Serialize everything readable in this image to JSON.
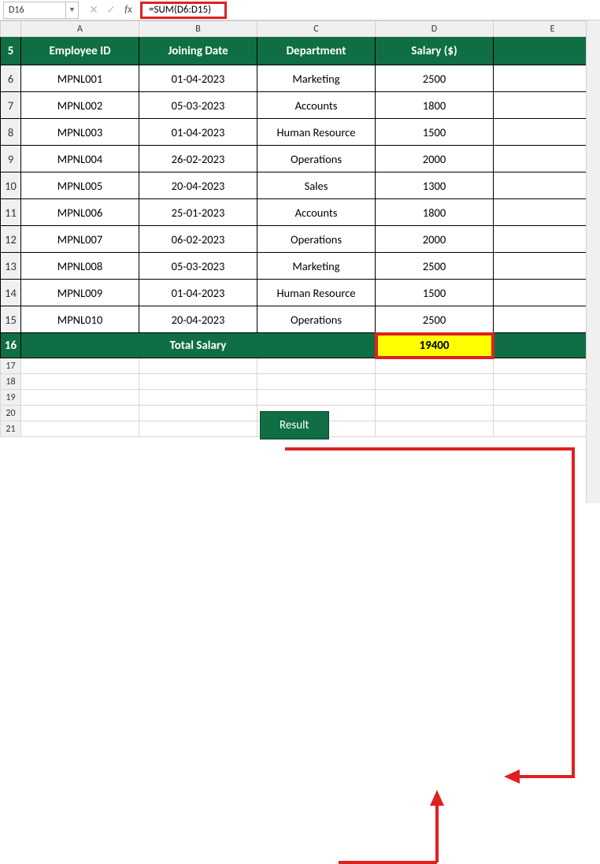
{
  "name_box": "D16",
  "formula": "=SUM(D6:D15)",
  "col_letters": [
    "A",
    "B",
    "C",
    "D",
    "E"
  ],
  "row_nums": [
    "5",
    "6",
    "7",
    "8",
    "9",
    "10",
    "11",
    "12",
    "13",
    "14",
    "15",
    "16",
    "17",
    "18",
    "19",
    "20",
    "21"
  ],
  "headers": {
    "c0": "Employee ID",
    "c1": "Joining Date",
    "c2": "Department",
    "c3": "Salary ($)"
  },
  "rows": [
    {
      "id": "MPNL001",
      "date": "01-04-2023",
      "dept": "Marketing",
      "sal": "2500"
    },
    {
      "id": "MPNL002",
      "date": "05-03-2023",
      "dept": "Accounts",
      "sal": "1800"
    },
    {
      "id": "MPNL003",
      "date": "01-04-2023",
      "dept": "Human Resource",
      "sal": "1500"
    },
    {
      "id": "MPNL004",
      "date": "26-02-2023",
      "dept": "Operations",
      "sal": "2000"
    },
    {
      "id": "MPNL005",
      "date": "20-04-2023",
      "dept": "Sales",
      "sal": "1300"
    },
    {
      "id": "MPNL006",
      "date": "25-01-2023",
      "dept": "Accounts",
      "sal": "1800"
    },
    {
      "id": "MPNL007",
      "date": "06-02-2023",
      "dept": "Operations",
      "sal": "2000"
    },
    {
      "id": "MPNL008",
      "date": "05-03-2023",
      "dept": "Marketing",
      "sal": "2500"
    },
    {
      "id": "MPNL009",
      "date": "01-04-2023",
      "dept": "Human Resource",
      "sal": "1500"
    },
    {
      "id": "MPNL010",
      "date": "20-04-2023",
      "dept": "Operations",
      "sal": "2500"
    }
  ],
  "total_label": "Total Salary",
  "total_value": "19400",
  "result_label": "Result",
  "chart_data": {
    "type": "table",
    "title": "Employee Salary Table with SUM",
    "columns": [
      "Employee ID",
      "Joining Date",
      "Department",
      "Salary ($)"
    ],
    "data": [
      [
        "MPNL001",
        "01-04-2023",
        "Marketing",
        2500
      ],
      [
        "MPNL002",
        "05-03-2023",
        "Accounts",
        1800
      ],
      [
        "MPNL003",
        "01-04-2023",
        "Human Resource",
        1500
      ],
      [
        "MPNL004",
        "26-02-2023",
        "Operations",
        2000
      ],
      [
        "MPNL005",
        "20-04-2023",
        "Sales",
        1300
      ],
      [
        "MPNL006",
        "25-01-2023",
        "Accounts",
        1800
      ],
      [
        "MPNL007",
        "06-02-2023",
        "Operations",
        2000
      ],
      [
        "MPNL008",
        "05-03-2023",
        "Marketing",
        2500
      ],
      [
        "MPNL009",
        "01-04-2023",
        "Human Resource",
        1500
      ],
      [
        "MPNL010",
        "20-04-2023",
        "Operations",
        2500
      ]
    ],
    "formula": "=SUM(D6:D15)",
    "result": 19400
  }
}
